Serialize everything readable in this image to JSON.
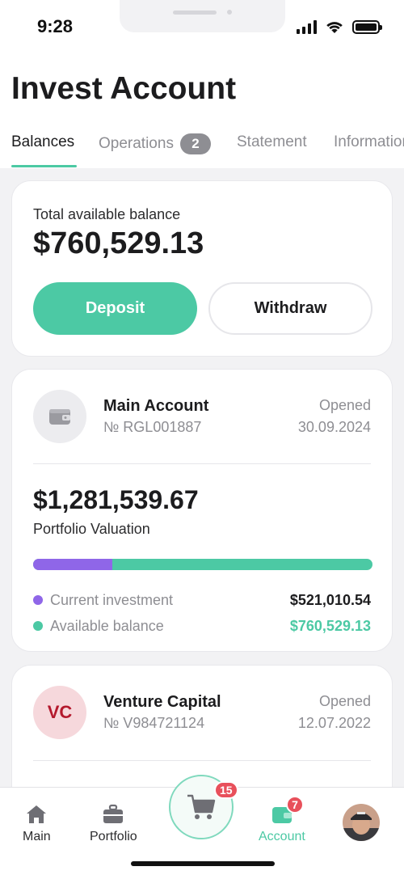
{
  "status_bar": {
    "time": "9:28"
  },
  "header": {
    "title": "Invest Account"
  },
  "tabs": [
    {
      "label": "Balances",
      "active": true
    },
    {
      "label": "Operations",
      "badge": "2"
    },
    {
      "label": "Statement"
    },
    {
      "label": "Information"
    }
  ],
  "balance_card": {
    "label": "Total available balance",
    "value": "$760,529.13",
    "deposit_label": "Deposit",
    "withdraw_label": "Withdraw"
  },
  "accounts": [
    {
      "name": "Main Account",
      "number": "№ RGL001887",
      "opened_label": "Opened",
      "opened_date": "30.09.2024",
      "icon": "wallet-icon",
      "portfolio_value": "$1,281,539.67",
      "portfolio_label": "Portfolio Valuation",
      "investment_share": 0.233,
      "legend": [
        {
          "label": "Current investment",
          "value": "$521,010.54",
          "color": "#8f66e8"
        },
        {
          "label": "Available balance",
          "value": "$760,529.13",
          "color": "#4cc9a4"
        }
      ]
    },
    {
      "name": "Venture Capital",
      "number": "№ V984721124",
      "opened_label": "Opened",
      "opened_date": "12.07.2022",
      "initials": "VC"
    }
  ],
  "bottom_nav": {
    "items": [
      {
        "label": "Main",
        "icon": "home-icon"
      },
      {
        "label": "Portfolio",
        "icon": "briefcase-icon"
      },
      {
        "label": "Account",
        "icon": "wallet-icon",
        "badge": "7",
        "active": true
      }
    ],
    "cart_badge": "15",
    "cart_icon": "cart-icon",
    "profile_icon": "profile-avatar"
  },
  "colors": {
    "accent": "#4cc9a4",
    "investment": "#8f66e8",
    "badge": "#e8505b",
    "vc": "#b4192d"
  }
}
